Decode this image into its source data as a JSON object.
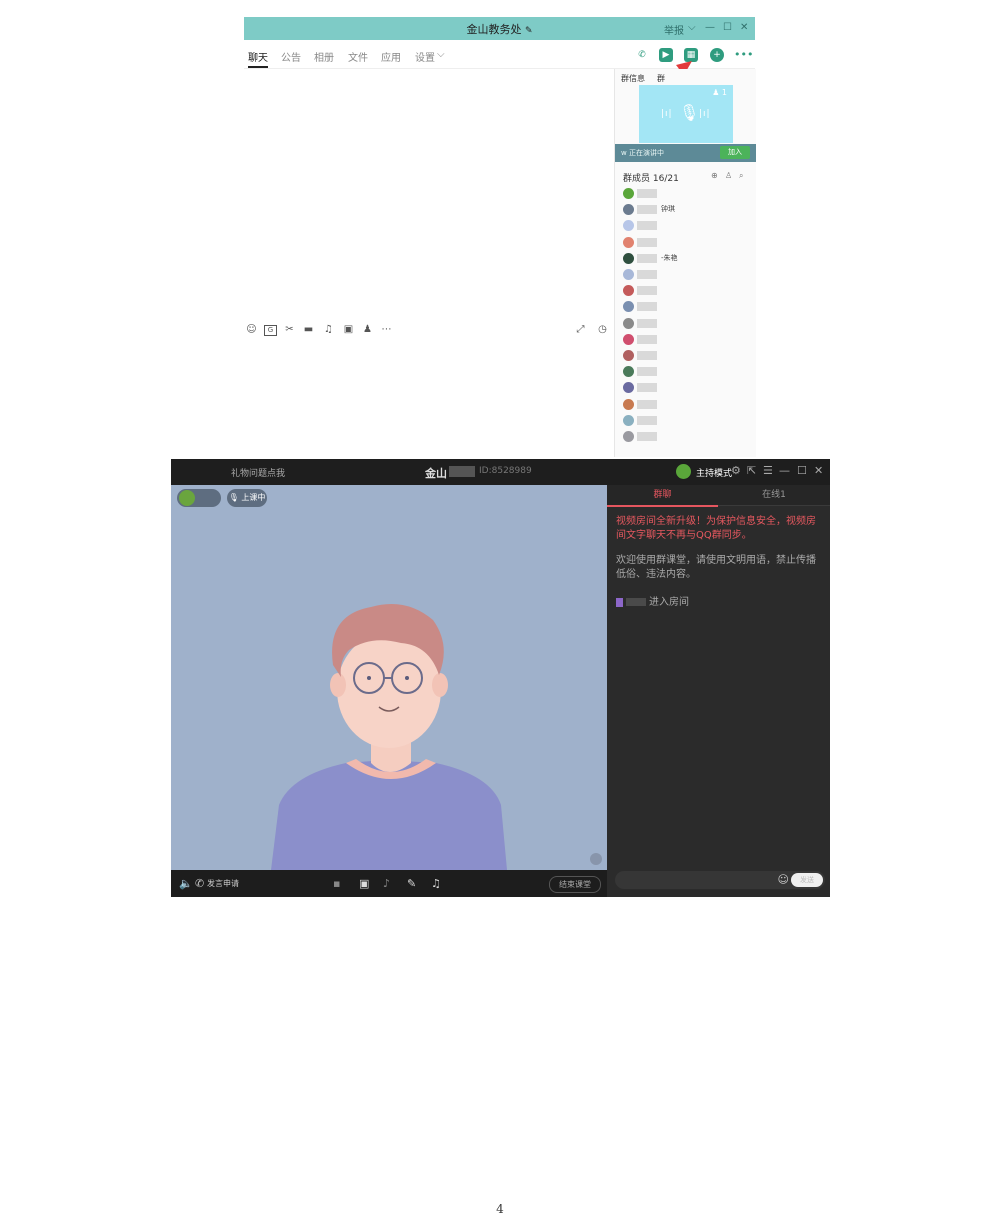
{
  "qq_window": {
    "title": "金山教务处",
    "title_edit_icon": "pencil-icon",
    "report_label": "举报",
    "tabs": [
      "聊天",
      "公告",
      "相册",
      "文件",
      "应用",
      "设置"
    ],
    "active_tab": "聊天",
    "toolbar_icons": [
      "phone-icon",
      "video-icon",
      "classroom-icon",
      "plus-icon",
      "more-icon"
    ],
    "side_tabs": [
      "群信息",
      "群"
    ],
    "live_count": "1",
    "live_status": "正在演讲中",
    "join_button": "加入",
    "members_title": "群成员 16/21",
    "member_suffixes": [
      "",
      "钟琪",
      "",
      "",
      "-朱艳",
      "",
      "",
      "",
      "",
      "",
      "",
      "",
      "",
      "",
      "",
      ""
    ],
    "chat_tool_icons": [
      "emoji-icon",
      "gif-icon",
      "scissors-icon",
      "folder-icon",
      "music-icon",
      "image-icon",
      "bell-icon",
      "more-icon"
    ]
  },
  "video_classroom": {
    "top_left_text": "礼物问题点我",
    "title": "金山",
    "room_id": "ID:8528989",
    "host_mode": "主持模式",
    "status_pill": "上课中",
    "side_tabs": {
      "group_chat": "群聊",
      "online": "在线1"
    },
    "notice": "视频房间全新升级！为保护信息安全，视频房间文字聊天不再与QQ群同步。",
    "rules": "欢迎使用群课堂，请使用文明用语，禁止传播低俗、违法内容。",
    "join_message": "进入房间",
    "apply_speak": "发言申请",
    "end_class": "结束课堂",
    "send_button": "发送"
  },
  "page_number": "4",
  "colors": {
    "title_bar": "#7ecbc6",
    "accent_red": "#e5565f",
    "stage_bg": "#9fb1cb",
    "join_green": "#4cb35a",
    "arrow_red": "#e23b3b"
  }
}
